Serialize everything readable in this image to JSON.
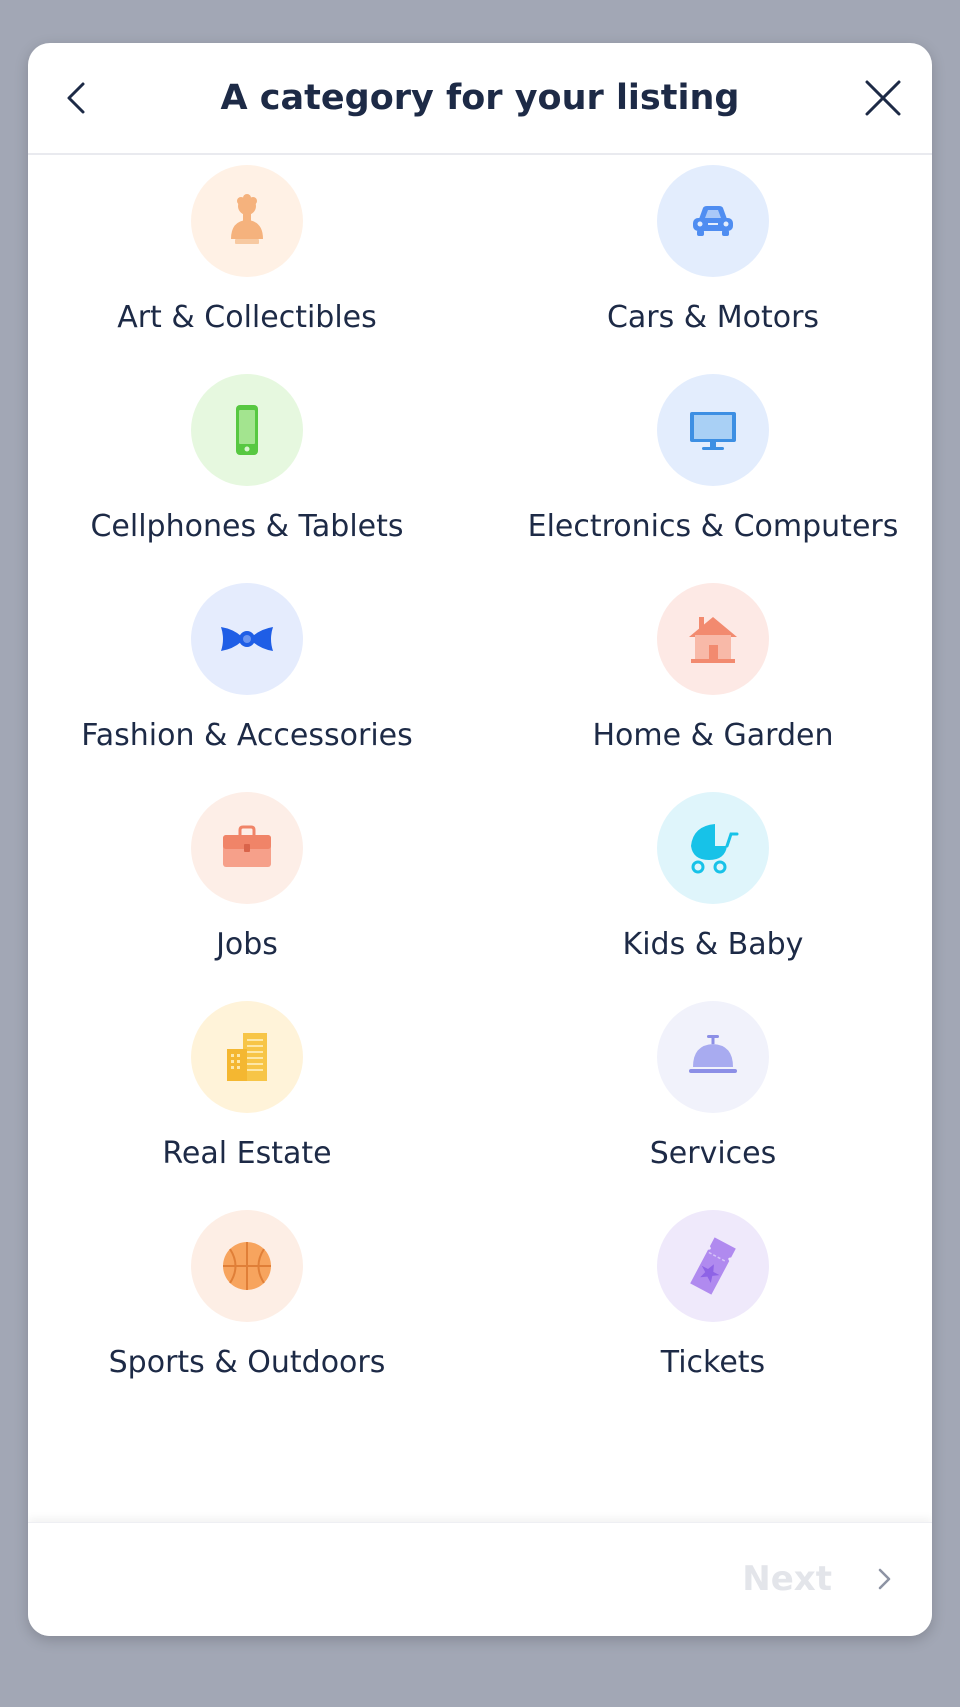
{
  "modal": {
    "title": "A category for your listing"
  },
  "categories": [
    {
      "label": "Art & Collectibles",
      "icon": "bust-statue-icon",
      "bg": "#fff1e5"
    },
    {
      "label": "Cars & Motors",
      "icon": "car-icon",
      "bg": "#e3edfd"
    },
    {
      "label": "Cellphones & Tablets",
      "icon": "cellphone-icon",
      "bg": "#e6f8df"
    },
    {
      "label": "Electronics & Computers",
      "icon": "monitor-icon",
      "bg": "#e3edfd"
    },
    {
      "label": "Fashion & Accessories",
      "icon": "bow-tie-icon",
      "bg": "#e5ecfd"
    },
    {
      "label": "Home & Garden",
      "icon": "house-icon",
      "bg": "#fde9e5"
    },
    {
      "label": "Jobs",
      "icon": "briefcase-icon",
      "bg": "#fdeee7"
    },
    {
      "label": "Kids & Baby",
      "icon": "baby-stroller-icon",
      "bg": "#dff5fb"
    },
    {
      "label": "Real Estate",
      "icon": "buildings-icon",
      "bg": "#fff3d9"
    },
    {
      "label": "Services",
      "icon": "service-bell-icon",
      "bg": "#f1f2fb"
    },
    {
      "label": "Sports & Outdoors",
      "icon": "basketball-icon",
      "bg": "#fdeee5"
    },
    {
      "label": "Tickets",
      "icon": "ticket-icon",
      "bg": "#efe9fb"
    }
  ],
  "footer": {
    "next_label": "Next"
  },
  "colors": {
    "backdrop": "#a2a7b5",
    "title_text": "#1d2a46",
    "next_disabled": "#e3e5ea"
  }
}
